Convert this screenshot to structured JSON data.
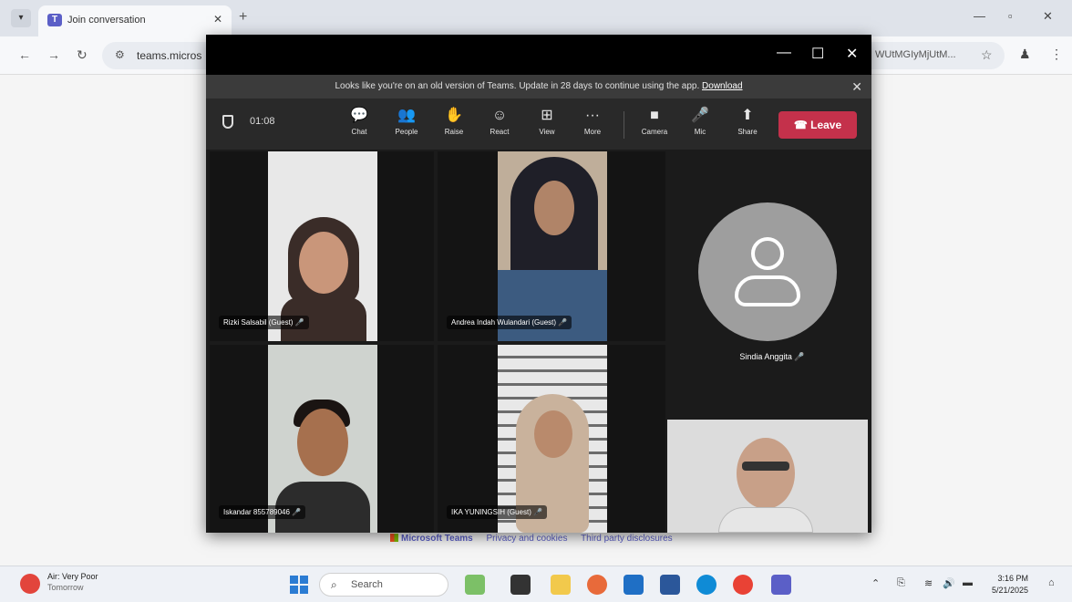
{
  "browser": {
    "tab_title": "Join conversation",
    "tab_close": "✕",
    "new_tab": "+",
    "url_left": "teams.micros",
    "url_right": "WUtMGIyMjUtM..."
  },
  "teams": {
    "banner_text": "Looks like you're on an old version of Teams. Update in 28 days to continue using the app.",
    "banner_link": "Download",
    "timer": "01:08",
    "controls": [
      {
        "label": "Chat",
        "icon": "💬"
      },
      {
        "label": "People",
        "icon": "👥"
      },
      {
        "label": "Raise",
        "icon": "✋"
      },
      {
        "label": "React",
        "icon": "☺"
      },
      {
        "label": "View",
        "icon": "⊞"
      },
      {
        "label": "More",
        "icon": "···"
      },
      {
        "label": "Camera",
        "icon": "■"
      },
      {
        "label": "Mic",
        "icon": "🎤"
      },
      {
        "label": "Share",
        "icon": "⬆"
      }
    ],
    "leave_label": "Leave",
    "participants": [
      {
        "name": "Rizki Salsabil (Guest)"
      },
      {
        "name": "Andrea Indah Wulandari (Guest)"
      },
      {
        "name": "Iskandar 855789046"
      },
      {
        "name": "IKA YUNINGSIH (Guest)"
      }
    ],
    "avatar_name": "Sindia Anggita"
  },
  "footer": {
    "brand": "Microsoft Teams",
    "privacy": "Privacy and cookies",
    "third_party": "Third party disclosures"
  },
  "taskbar": {
    "weather_title": "Air: Very Poor",
    "weather_sub": "Tomorrow",
    "search_placeholder": "Search",
    "time": "3:16 PM",
    "date": "5/21/2025"
  }
}
